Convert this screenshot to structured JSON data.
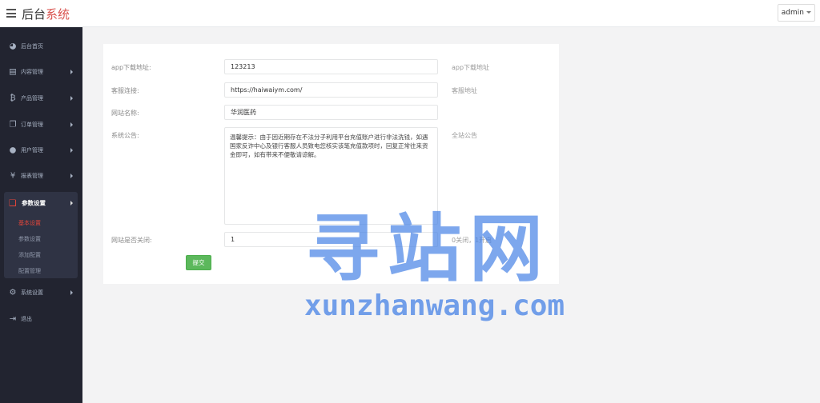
{
  "topbar": {
    "brand_main": "后台",
    "brand_accent": "系统",
    "user": "admin"
  },
  "colors": {
    "sidebar_bg": "#222430",
    "active_accent": "#e4453a",
    "submit_green": "#5cb85c"
  },
  "sidebar": {
    "items": [
      {
        "label": "后台首页",
        "icon": "dashboard-icon"
      },
      {
        "label": "内容管理",
        "icon": "book-icon"
      },
      {
        "label": "产品管理",
        "icon": "bitcoin-icon"
      },
      {
        "label": "订单管理",
        "icon": "copy-icon"
      },
      {
        "label": "用户管理",
        "icon": "user-icon"
      },
      {
        "label": "报表管理",
        "icon": "yen-icon"
      }
    ],
    "active_group": {
      "label": "参数设置",
      "icon": "files-icon",
      "children": [
        "基本设置",
        "参数设置",
        "添加配置",
        "配置管理"
      ]
    },
    "bottom_items": [
      {
        "label": "系统设置",
        "icon": "gears-icon"
      },
      {
        "label": "退出",
        "icon": "sign-out-icon"
      }
    ]
  },
  "form": {
    "app_download": {
      "label": "app下载地址:",
      "value": "123213",
      "help": "app下载地址"
    },
    "service_link": {
      "label": "客服连接:",
      "value": "https://haiwaiym.com/",
      "help": "客服地址"
    },
    "site_name": {
      "label": "网站名称:",
      "value": "华润医药"
    },
    "notice": {
      "label": "系统公告:",
      "value": "温馨提示：由于因近期存在不法分子利用平台充值账户进行非法洗钱，如遇国家反诈中心及银行客服人员致电您核实该笔充值款项时，回复正常往来资金即可，如有带来不便敬请谅解。",
      "help": "全站公告"
    },
    "site_closed": {
      "label": "网站是否关闭:",
      "value": "1",
      "help": "0关闭，1开启"
    },
    "submit_label": "提交"
  },
  "watermark": {
    "cn": "寻站网",
    "en": "xunzhanwang.com"
  }
}
